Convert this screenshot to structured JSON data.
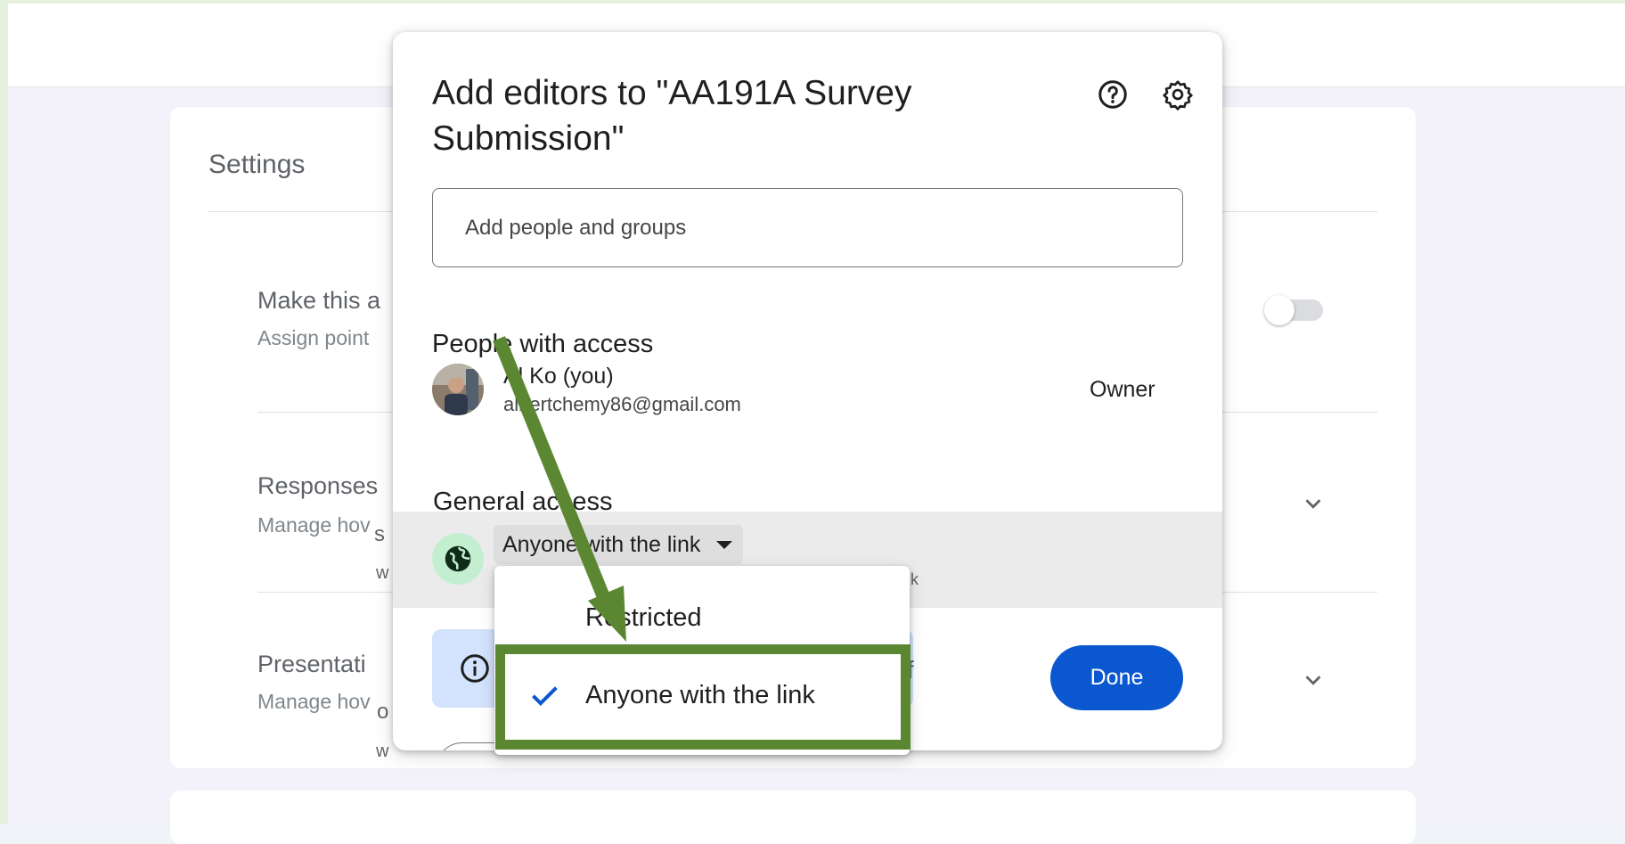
{
  "settings": {
    "title": "Settings",
    "rows": [
      {
        "title": "Make this a",
        "subtitle": "Assign point"
      },
      {
        "title": "Responses",
        "subtitle": "Manage hov"
      },
      {
        "title": "Presentati",
        "subtitle": "Manage hov"
      }
    ]
  },
  "dialog": {
    "title": "Add editors to \"AA191A Survey Submission\"",
    "add_placeholder": "Add people and groups",
    "people_heading": "People with access",
    "person": {
      "name": "Al Ko (you)",
      "email": "albertchemy86@gmail.com",
      "role": "Owner"
    },
    "general_heading": "General access",
    "access_value": "Anyone with the link",
    "done_label": "Done"
  },
  "dropdown": {
    "options": [
      {
        "label": "Restricted",
        "selected": false
      },
      {
        "label": "Anyone with the link",
        "selected": true
      }
    ]
  },
  "bleed": {
    "s1": "s",
    "w1": "w",
    "o1": "o",
    "w2": "w",
    "f1": "f",
    "k1": "k"
  },
  "colors": {
    "accent": "#0b57d0",
    "annotation": "#5b8732",
    "check": "#0b57d0"
  },
  "icons": [
    "help-icon",
    "settings-gear-icon",
    "globe-icon",
    "info-icon",
    "check-icon",
    "chevron-down-icon",
    "arrow-annotation"
  ]
}
